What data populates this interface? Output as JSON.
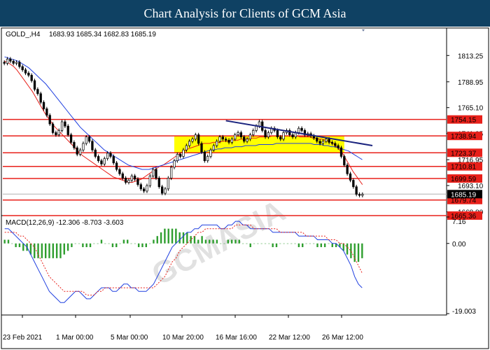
{
  "banner": {
    "title": "Chart Analysis for Clients of GCM Asia"
  },
  "watermark": "GCMASIA",
  "chart_data": {
    "type": "candlestick",
    "symbol_header": "GOLD_,H4",
    "ohlc_header": "1683.93 1685.34 1682.83 1685.19",
    "price_axis": {
      "min": 1655.0,
      "max": 1827.0,
      "ticks": [
        1813.25,
        1788.95,
        1765.1,
        1741.25,
        1716.95,
        1693.1,
        1668.8
      ]
    },
    "last_price": 1685.19,
    "levels": [
      {
        "value": 1754.15,
        "label": "1754.15"
      },
      {
        "value": 1738.94,
        "label": "1738.94"
      },
      {
        "value": 1723.37,
        "label": "1723.37"
      },
      {
        "value": 1710.81,
        "label": "1710.81"
      },
      {
        "value": 1699.59,
        "label": "1699.59"
      },
      {
        "value": 1679.74,
        "label": "1679.74"
      },
      {
        "value": 1665.36,
        "label": "1665.36"
      }
    ],
    "time_labels": [
      "23 Feb 2021",
      "1 Mar 00:00",
      "5 Mar 00:00",
      "10 Mar 20:00",
      "16 Mar 16:00",
      "22 Mar 12:00",
      "26 Mar 12:00"
    ],
    "candles_close": [
      1806,
      1810,
      1808,
      1806,
      1807,
      1803,
      1800,
      1797,
      1795,
      1790,
      1782,
      1778,
      1770,
      1764,
      1758,
      1750,
      1742,
      1740,
      1744,
      1752,
      1748,
      1740,
      1733,
      1728,
      1722,
      1726,
      1732,
      1738,
      1734,
      1726,
      1720,
      1716,
      1713,
      1718,
      1723,
      1720,
      1714,
      1708,
      1704,
      1700,
      1696,
      1698,
      1702,
      1699,
      1694,
      1690,
      1688,
      1693,
      1702,
      1708,
      1700,
      1692,
      1686,
      1690,
      1700,
      1710,
      1716,
      1722,
      1720,
      1726,
      1730,
      1734,
      1736,
      1740,
      1732,
      1724,
      1716,
      1720,
      1726,
      1730,
      1734,
      1738,
      1736,
      1735,
      1733,
      1736,
      1740,
      1742,
      1738,
      1734,
      1736,
      1740,
      1744,
      1748,
      1752,
      1744,
      1738,
      1742,
      1746,
      1744,
      1738,
      1736,
      1742,
      1744,
      1740,
      1738,
      1742,
      1746,
      1744,
      1740,
      1741,
      1739,
      1737,
      1734,
      1732,
      1734,
      1736,
      1733,
      1732,
      1730,
      1728,
      1720,
      1712,
      1704,
      1698,
      1692,
      1685,
      1684,
      1685
    ],
    "ma_fast": [
      1808,
      1807,
      1805,
      1803,
      1800,
      1796,
      1792,
      1788,
      1784,
      1780,
      1775,
      1770,
      1765,
      1760,
      1756,
      1752,
      1748,
      1745,
      1742,
      1739,
      1736,
      1733,
      1730,
      1727,
      1724,
      1721,
      1719,
      1717,
      1715,
      1713,
      1711,
      1709,
      1707,
      1705,
      1703,
      1701,
      1700,
      1699,
      1698,
      1697,
      1696,
      1696,
      1697,
      1698,
      1699,
      1701,
      1703,
      1705,
      1707,
      1709,
      1711,
      1712,
      1714,
      1716,
      1718,
      1720,
      1722,
      1724,
      1725,
      1727,
      1728,
      1729,
      1730,
      1731,
      1732,
      1732,
      1732,
      1733,
      1733,
      1733,
      1734,
      1734,
      1734,
      1735,
      1735,
      1735,
      1736,
      1736,
      1736,
      1737,
      1737,
      1737,
      1738,
      1738,
      1738,
      1738,
      1739,
      1739,
      1739,
      1739,
      1739,
      1739,
      1739,
      1739,
      1739,
      1738,
      1738,
      1738,
      1738,
      1737,
      1737,
      1736,
      1736,
      1735,
      1734,
      1733,
      1731,
      1728,
      1725,
      1721,
      1716,
      1711,
      1706,
      1702,
      1698,
      1694
    ],
    "ma_slow": [
      1812,
      1811,
      1810,
      1809,
      1808,
      1806,
      1804,
      1802,
      1799,
      1796,
      1793,
      1790,
      1787,
      1783,
      1779,
      1775,
      1771,
      1767,
      1763,
      1759,
      1755,
      1751,
      1747,
      1744,
      1741,
      1738,
      1735,
      1732,
      1729,
      1726,
      1724,
      1722,
      1720,
      1718,
      1716,
      1714,
      1712,
      1711,
      1710,
      1709,
      1708,
      1708,
      1708,
      1709,
      1710,
      1711,
      1712,
      1713,
      1714,
      1715,
      1716,
      1717,
      1718,
      1719,
      1720,
      1721,
      1722,
      1723,
      1724,
      1725,
      1726,
      1726,
      1727,
      1727,
      1728,
      1728,
      1728,
      1729,
      1729,
      1729,
      1730,
      1730,
      1730,
      1730,
      1731,
      1731,
      1731,
      1731,
      1731,
      1732,
      1732,
      1732,
      1732,
      1732,
      1732,
      1732,
      1732,
      1732,
      1732,
      1732,
      1731,
      1731,
      1731,
      1730,
      1730,
      1729,
      1729,
      1728,
      1727,
      1726,
      1725,
      1723,
      1721,
      1719,
      1717
    ],
    "macd": {
      "header": "MACD(12,26,9) -12.306 -8.703 -3.603",
      "axis": {
        "min": -19.003,
        "max": 7.16,
        "ticks": [
          7.16,
          0.0,
          -19.003
        ],
        "tick_labels": [
          "7.16",
          "0.00",
          "-19.003"
        ]
      },
      "macd_line": [
        4,
        4,
        3,
        2,
        1,
        0,
        -1,
        -3,
        -5,
        -7,
        -9,
        -11,
        -13,
        -14,
        -15,
        -16,
        -16,
        -15,
        -14,
        -13,
        -13,
        -14,
        -15,
        -15,
        -14,
        -13,
        -12,
        -12,
        -12,
        -13,
        -13,
        -12,
        -11,
        -11,
        -12,
        -12,
        -13,
        -13,
        -13,
        -12,
        -11,
        -9,
        -7,
        -5,
        -3,
        -1,
        0,
        1,
        2,
        3,
        3,
        4,
        4,
        5,
        5,
        5,
        5,
        5,
        4,
        4,
        5,
        5,
        6,
        6,
        5,
        5,
        4,
        4,
        4,
        4,
        4,
        4,
        3,
        3,
        3,
        3,
        3,
        3,
        3,
        2,
        2,
        2,
        2,
        2,
        1,
        1,
        1,
        1,
        0,
        0,
        -1,
        -2,
        -4,
        -6,
        -9,
        -11,
        -12
      ],
      "signal_line": [
        3,
        3,
        3,
        3,
        2,
        2,
        1,
        0,
        -1,
        -3,
        -5,
        -7,
        -9,
        -10,
        -11,
        -12,
        -13,
        -13,
        -13,
        -13,
        -13,
        -13,
        -14,
        -14,
        -14,
        -13,
        -13,
        -12,
        -12,
        -12,
        -12,
        -12,
        -12,
        -12,
        -12,
        -12,
        -12,
        -12,
        -12,
        -12,
        -12,
        -11,
        -10,
        -9,
        -7,
        -5,
        -4,
        -2,
        -1,
        0,
        1,
        2,
        3,
        3,
        4,
        4,
        4,
        4,
        4,
        4,
        4,
        4,
        5,
        5,
        5,
        5,
        5,
        4,
        4,
        4,
        4,
        4,
        4,
        4,
        3,
        3,
        3,
        3,
        3,
        3,
        3,
        2,
        2,
        2,
        2,
        2,
        2,
        1,
        1,
        1,
        0,
        0,
        -1,
        -2,
        -4,
        -6,
        -8
      ]
    }
  }
}
